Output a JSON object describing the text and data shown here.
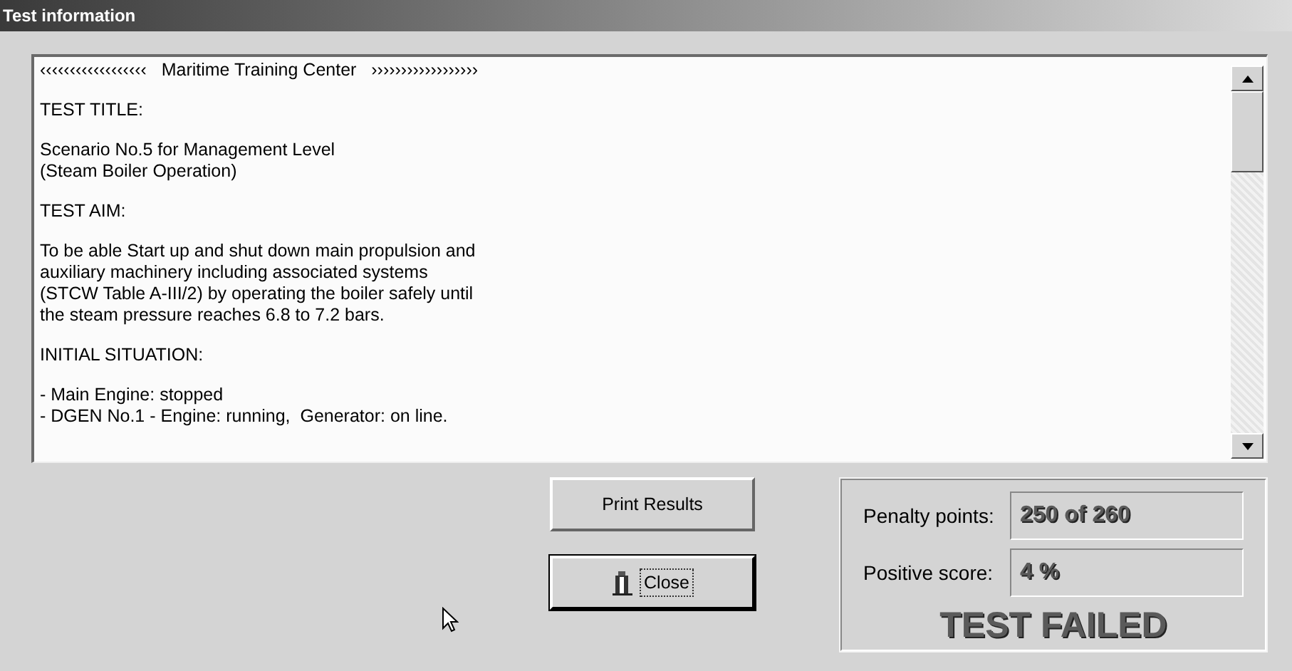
{
  "window": {
    "title": "Test information"
  },
  "report": {
    "paragraphs": [
      [
        "‹‹‹‹‹‹‹‹‹‹‹‹‹‹‹‹‹‹   Maritime Training Center   ››››››››››››››››››"
      ],
      [
        "TEST TITLE:"
      ],
      [
        "Scenario No.5 for Management Level",
        "(Steam Boiler Operation)"
      ],
      [
        "TEST AIM:"
      ],
      [
        "To be able Start up and shut down main propulsion and",
        "auxiliary machinery including associated systems",
        "(STCW Table A-III/2) by operating the boiler safely until",
        "the steam pressure reaches 6.8 to 7.2 bars."
      ],
      [
        "INITIAL SITUATION:"
      ],
      [
        "- Main Engine: stopped",
        "- DGEN No.1 - Engine: running,  Generator: on line."
      ]
    ]
  },
  "buttons": [
    {
      "label": "Print Results",
      "icon": false,
      "focused": false
    },
    {
      "label": "Close",
      "icon": true,
      "focused": true
    }
  ],
  "results": {
    "fields": [
      {
        "label": "Penalty points:",
        "value": "250 of 260"
      },
      {
        "label": "Positive score:",
        "value": "4 %"
      }
    ],
    "verdict": "TEST FAILED"
  }
}
